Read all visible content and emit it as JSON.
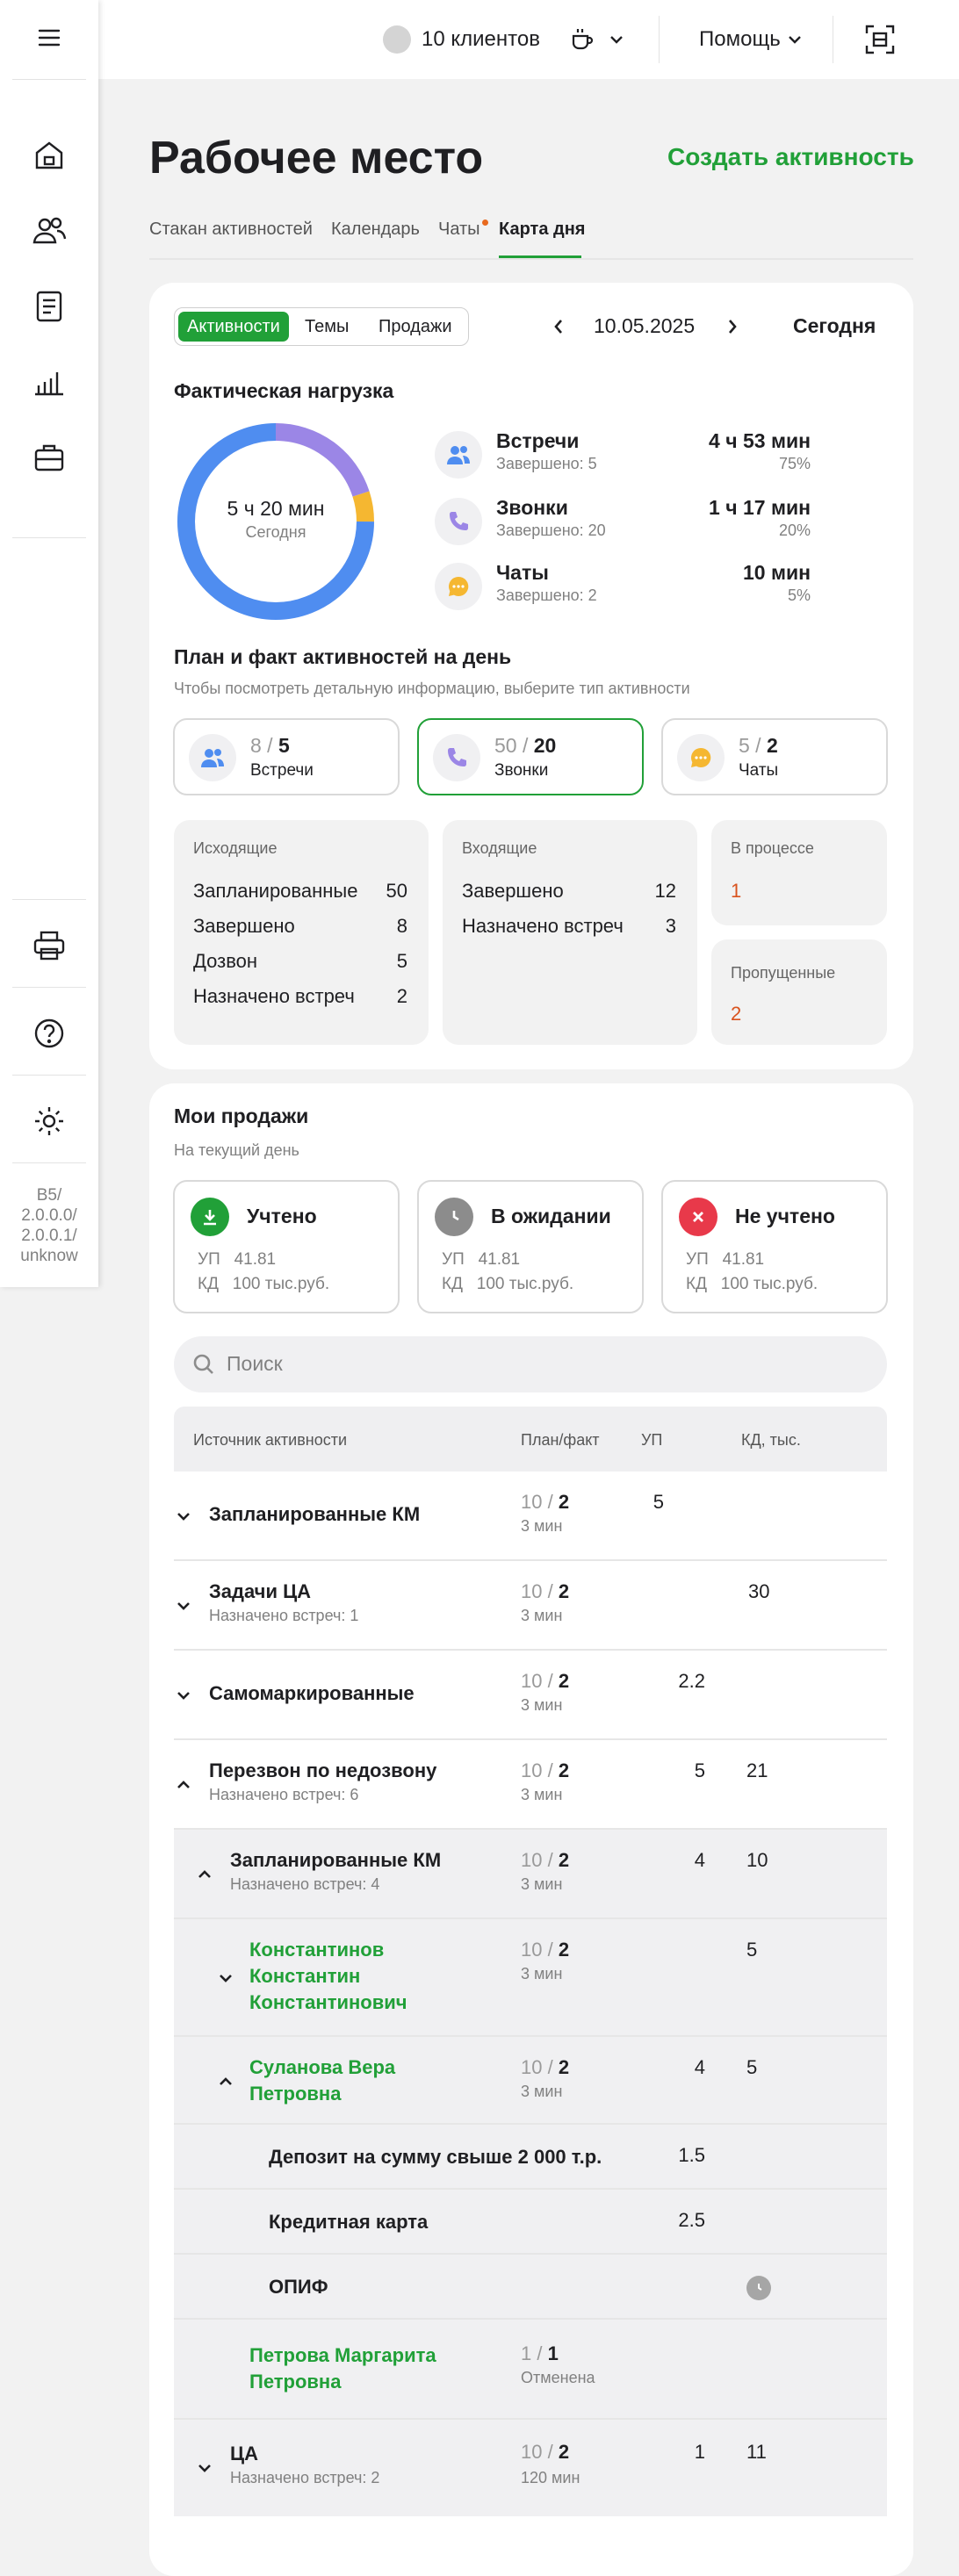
{
  "sidebar": {
    "version": [
      "B5/",
      "2.0.0.0/",
      "2.0.0.1/",
      "unknow"
    ]
  },
  "topbar": {
    "clients": "10 клиентов",
    "help": "Помощь"
  },
  "page": {
    "title": "Рабочее место",
    "create": "Создать активность",
    "tabs": [
      "Стакан активностей",
      "Календарь",
      "Чаты",
      "Карта дня"
    ],
    "active_tab": "Карта дня"
  },
  "activity_card": {
    "segments": [
      "Активности",
      "Темы",
      "Продажи"
    ],
    "date": "10.05.2025",
    "today": "Сегодня",
    "load_title": "Фактическая нагрузка",
    "donut_center": "5 ч 20 мин",
    "donut_sub": "Сегодня",
    "legend": [
      {
        "name": "Встречи",
        "done": "Завершено: 5",
        "time": "4 ч 53 мин",
        "pct": "75%"
      },
      {
        "name": "Звонки",
        "done": "Завершено: 20",
        "time": "1 ч 17 мин",
        "pct": "20%"
      },
      {
        "name": "Чаты",
        "done": "Завершено: 2",
        "time": "10 мин",
        "pct": "5%"
      }
    ],
    "plan_title": "План и факт активностей на день",
    "plan_hint": "Чтобы посмотреть детальную информацию, выберите тип активности",
    "plan_cards": [
      {
        "fact": "8",
        "plan": "5",
        "label": "Встречи"
      },
      {
        "fact": "50",
        "plan": "20",
        "label": "Звонки"
      },
      {
        "fact": "5",
        "plan": "2",
        "label": "Чаты"
      }
    ],
    "outgoing": {
      "title": "Исходящие",
      "rows": [
        {
          "k": "Запланированные",
          "v": "50"
        },
        {
          "k": "Завершено",
          "v": "8"
        },
        {
          "k": "Дозвон",
          "v": "5"
        },
        {
          "k": "Назначено встреч",
          "v": "2"
        }
      ]
    },
    "incoming": {
      "title": "Входящие",
      "rows": [
        {
          "k": "Завершено",
          "v": "12"
        },
        {
          "k": "Назначено встреч",
          "v": "3"
        }
      ]
    },
    "in_progress": {
      "title": "В процессе",
      "v": "1"
    },
    "missed": {
      "title": "Пропущенные",
      "v": "2"
    }
  },
  "sales": {
    "title": "Мои продажи",
    "sub": "На текущий день",
    "cards": [
      {
        "title": "Учтено",
        "up_k": "УП",
        "up_v": "41.81",
        "kd_k": "КД",
        "kd_v": "100 тыс.руб."
      },
      {
        "title": "В ожидании",
        "up_k": "УП",
        "up_v": "41.81",
        "kd_k": "КД",
        "kd_v": "100 тыс.руб."
      },
      {
        "title": "Не учтено",
        "up_k": "УП",
        "up_v": "41.81",
        "kd_k": "КД",
        "kd_v": "100 тыс.руб."
      }
    ],
    "search_placeholder": "Поиск",
    "table_headers": [
      "Источник активности",
      "План/факт",
      "УП",
      "КД, тыс."
    ],
    "rows": [
      {
        "name": "Запланированные КМ",
        "sub": "",
        "fact": "10",
        "plan": "2",
        "min": "3 мин",
        "up": "5",
        "kd": ""
      },
      {
        "name": "Задачи ЦА",
        "sub": "Назначено встреч: 1",
        "fact": "10",
        "plan": "2",
        "min": "3 мин",
        "up": "",
        "kd": "30"
      },
      {
        "name": "Самомаркированные",
        "sub": "",
        "fact": "10",
        "plan": "2",
        "min": "3 мин",
        "up": "2.2",
        "kd": ""
      },
      {
        "name": "Перезвон по недозвону",
        "sub": "Назначено встреч: 6",
        "fact": "10",
        "plan": "2",
        "min": "3 мин",
        "up": "5",
        "kd": "21"
      },
      {
        "name": "Запланированные КМ",
        "sub": "Назначено встреч: 4",
        "fact": "10",
        "plan": "2",
        "min": "3 мин",
        "up": "4",
        "kd": "10"
      },
      {
        "name": "Константинов Константин Константинович",
        "sub": "",
        "fact": "10",
        "plan": "2",
        "min": "3 мин",
        "up": "",
        "kd": "5"
      },
      {
        "name": "Суланова Вера Петровна",
        "sub": "",
        "fact": "10",
        "plan": "2",
        "min": "3 мин",
        "up": "4",
        "kd": "5"
      },
      {
        "name": "Депозит на сумму свыше 2 000 т.р.",
        "up": "1.5"
      },
      {
        "name": "Кредитная карта",
        "up": "2.5"
      },
      {
        "name": "ОПИФ"
      },
      {
        "name": "Петрова Маргарита Петровна",
        "fact": "1",
        "plan": "1",
        "min": "Отменена"
      },
      {
        "name": "ЦА",
        "sub": "Назначено встреч: 2",
        "fact": "10",
        "plan": "2",
        "min": "120 мин",
        "up": "1",
        "kd": "11"
      }
    ]
  },
  "colors": {
    "accent": "#21a038",
    "meetings": "#4f8df0",
    "calls": "#9b86e6",
    "chats": "#f5b731",
    "missed": "#d9531e",
    "error": "#e8394a"
  },
  "chart_data": {
    "type": "pie",
    "categories": [
      "Встречи",
      "Звонки",
      "Чаты"
    ],
    "values": [
      75,
      20,
      5
    ]
  }
}
